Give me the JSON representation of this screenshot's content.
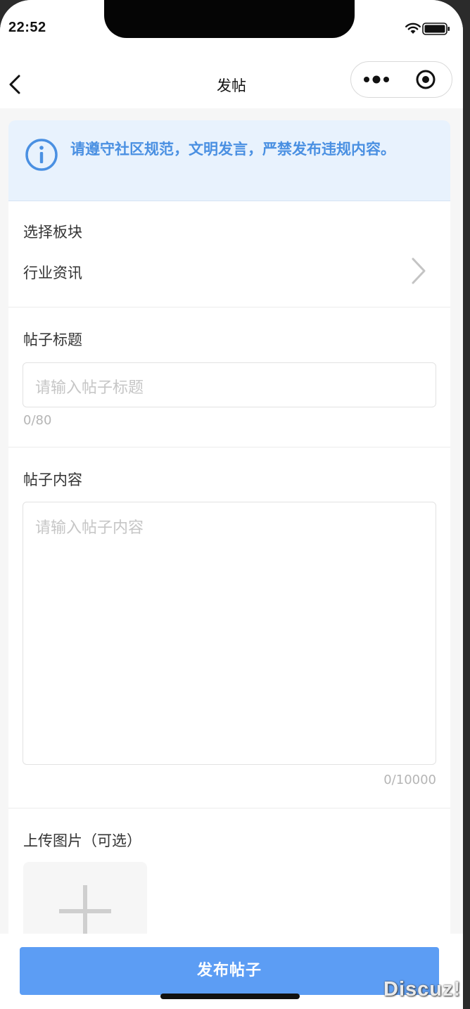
{
  "status_bar": {
    "time": "22:52"
  },
  "nav": {
    "title": "发帖"
  },
  "notice": {
    "text": "请遵守社区规范，文明发言，严禁发布违规内容。"
  },
  "board": {
    "label": "选择板块",
    "value": "行业资讯"
  },
  "title_field": {
    "label": "帖子标题",
    "placeholder": "请输入帖子标题",
    "counter": "0/80"
  },
  "content_field": {
    "label": "帖子内容",
    "placeholder": "请输入帖子内容",
    "counter": "0/10000"
  },
  "upload": {
    "label": "上传图片（可选）"
  },
  "submit": {
    "label": "发布帖子"
  },
  "watermark": "Discuz!",
  "colors": {
    "accent": "#5c9df4",
    "notice_text": "#4a90e2",
    "notice_bg": "#e8f2fd"
  },
  "icons": [
    "wifi-icon",
    "battery-icon",
    "back-arrow-icon",
    "more-dots-icon",
    "target-circle-icon",
    "info-icon",
    "chevron-right-icon",
    "plus-icon"
  ]
}
